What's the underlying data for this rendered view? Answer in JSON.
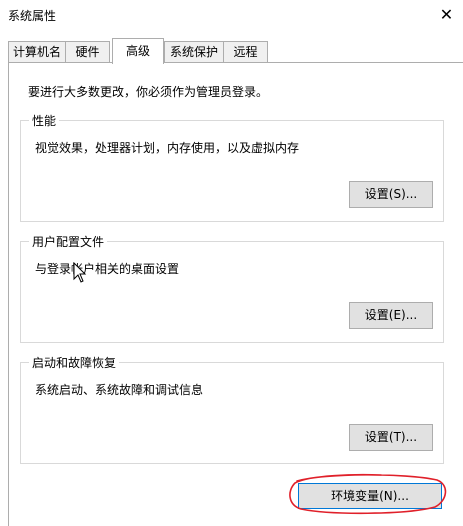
{
  "window": {
    "title": "系统属性",
    "close_glyph": "✕"
  },
  "tabs": [
    {
      "label": "计算机名",
      "active": false
    },
    {
      "label": "硬件",
      "active": false
    },
    {
      "label": "高级",
      "active": true
    },
    {
      "label": "系统保护",
      "active": false
    },
    {
      "label": "远程",
      "active": false
    }
  ],
  "advanced": {
    "admin_note": "要进行大多数更改，你必须作为管理员登录。",
    "performance": {
      "legend": "性能",
      "description": "视觉效果，处理器计划，内存使用，以及虚拟内存",
      "button": "设置(S)..."
    },
    "user_profiles": {
      "legend": "用户配置文件",
      "description": "与登录帐户相关的桌面设置",
      "button": "设置(E)..."
    },
    "startup_recovery": {
      "legend": "启动和故障恢复",
      "description": "系统启动、系统故障和调试信息",
      "button": "设置(T)..."
    },
    "env_button": "环境变量(N)..."
  },
  "colors": {
    "annotation": "#e0202a",
    "focus_border": "#0078d7"
  }
}
